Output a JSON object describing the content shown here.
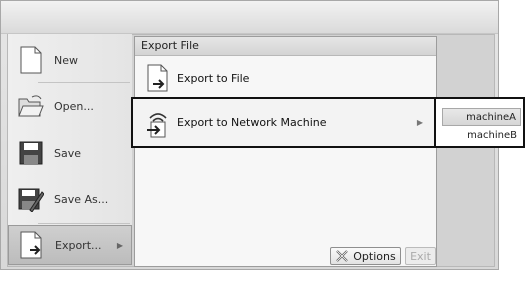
{
  "left_menu": {
    "items": [
      {
        "label": "New",
        "icon": "new-file-icon"
      },
      {
        "label": "Open...",
        "icon": "open-folder-icon"
      },
      {
        "label": "Save",
        "icon": "save-icon"
      },
      {
        "label": "Save As...",
        "icon": "save-as-icon"
      },
      {
        "label": "Export...",
        "icon": "export-icon"
      }
    ]
  },
  "export_panel": {
    "header": "Export File",
    "items": [
      {
        "label": "Export to File",
        "icon": "export-file-icon"
      },
      {
        "label": "Export to Network Machine",
        "icon": "network-export-icon"
      }
    ]
  },
  "machines": [
    "machineA",
    "machineB"
  ],
  "footer": {
    "options_label": "Options",
    "exit_label": "Exit"
  }
}
